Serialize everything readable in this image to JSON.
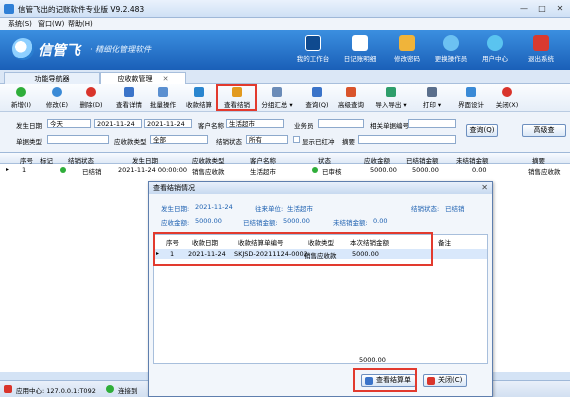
{
  "window": {
    "title": "信管飞出的记账软件专业版 V9.2.483",
    "min": "—",
    "max": "□",
    "close": "✕"
  },
  "menu": [
    "系统(S)",
    "窗口(W)",
    "帮助(H)"
  ],
  "banner": {
    "logo": "信管飞",
    "slogan": "· 精细化管理软件",
    "nav": [
      {
        "label": "我的工作台",
        "icon": "monitor-icon",
        "color": "#1b5fa8"
      },
      {
        "label": "日记账明细",
        "icon": "grid-icon",
        "color": "#2e7bd2"
      },
      {
        "label": "修改密码",
        "icon": "lock-icon",
        "color": "#e3a42a"
      },
      {
        "label": "更换操作员",
        "icon": "user-icon",
        "color": "#3fa0e6"
      },
      {
        "label": "用户中心",
        "icon": "globe-icon",
        "color": "#38b0e8"
      },
      {
        "label": "退出系统",
        "icon": "power-icon",
        "color": "#d93a2f"
      }
    ]
  },
  "tabs": [
    {
      "label": "功能导航器",
      "close": ""
    },
    {
      "label": "应收款管理",
      "close": "✕"
    }
  ],
  "toolbar": [
    {
      "label": "新增(I)",
      "icon": "add-icon",
      "color": "#2fae3a"
    },
    {
      "label": "修改(E)",
      "icon": "edit-icon",
      "color": "#3a8ad6"
    },
    {
      "label": "删除(D)",
      "icon": "delete-icon",
      "color": "#d9342b"
    },
    {
      "label": "查看详情",
      "icon": "detail-icon",
      "color": "#3b74c9"
    },
    {
      "label": "批量操作",
      "icon": "batch-icon",
      "color": "#5a8fd0"
    },
    {
      "label": "收款结算",
      "icon": "settle-icon",
      "color": "#2a86cf"
    },
    {
      "label": "查看结销",
      "icon": "view-settle-icon",
      "color": "#e29a1f"
    },
    {
      "label": "分组汇总 ▾",
      "icon": "group-icon",
      "color": "#6b8cb8"
    },
    {
      "label": "查询(Q)",
      "icon": "query-icon",
      "color": "#3b74c9"
    },
    {
      "label": "高级查询",
      "icon": "advanced-query-icon",
      "color": "#d9542b"
    },
    {
      "label": "导入导出 ▾",
      "icon": "import-export-icon",
      "color": "#2f9e6b"
    },
    {
      "label": "打印 ▾",
      "icon": "print-icon",
      "color": "#5a6f8c"
    },
    {
      "label": "界面设计",
      "icon": "design-icon",
      "color": "#3a8ad6"
    },
    {
      "label": "关闭(X)",
      "icon": "close-icon",
      "color": "#d9342b"
    }
  ],
  "filters": {
    "date_label": "发生日期",
    "date_preset": "今天",
    "date_from": "2021-11-24",
    "date_to": "2021-11-24",
    "customer_label": "客户名称",
    "customer_value": "生活超市",
    "clerk_label": "业务员",
    "clerk_value": "",
    "related_label": "相关单据编号",
    "related_value": "",
    "doctype_label": "单据类型",
    "doctype_value": "",
    "paytype_label": "应收款类型",
    "paytype_value": "全部",
    "status_label": "结销状态",
    "status_value": "所有",
    "red_label": "显示已红冲",
    "summary_label": "摘要",
    "summary_value": "",
    "query_button": "查询(Q)",
    "advanced_button": "高级查"
  },
  "grid": {
    "headers": [
      "序号",
      "标记",
      "结销状态",
      "发生日期",
      "应收款类型",
      "客户名称",
      "状态",
      "应收金额",
      "已结销金额",
      "未结销金额",
      "摘要"
    ],
    "rows": [
      {
        "no": "1",
        "flag": "",
        "settle_status": "已结销",
        "date": "2021-11-24 00:00:00",
        "type": "销售应收款",
        "customer": "生活超市",
        "status": "已审核",
        "amount": "5000.00",
        "settled": "5000.00",
        "unsettled": "0.00",
        "memo": "销售应收款"
      }
    ]
  },
  "dialog": {
    "title": "查看结销情况",
    "close": "✕",
    "date_label": "发生日期:",
    "date_value": "2021-11-24",
    "unit_label": "往来单位:",
    "unit_value": "生活超市",
    "status_label": "结销状态:",
    "status_value": "已结销",
    "amount_label": "应收金额:",
    "amount_value": "5000.00",
    "settled_label": "已结销金额:",
    "settled_value": "5000.00",
    "unsettled_label": "未结销金额:",
    "unsettled_value": "0.00",
    "headers": [
      "序号",
      "收款日期",
      "收款结算单编号",
      "收款类型",
      "本次结销金额",
      "备注"
    ],
    "rows": [
      {
        "no": "1",
        "date": "2021-11-24",
        "code": "SKJSD-20211124-0002",
        "type": "销售应收款",
        "amount": "5000.00",
        "memo": ""
      }
    ],
    "total": "5000.00",
    "view_button": "查看结算单",
    "close_button": "关闭(C)"
  },
  "statusbar": {
    "app_center": "应用中心: 127.0.0.1:T092",
    "connected": "连接到"
  },
  "colors": {
    "banner": "#1a5fb8",
    "highlight": "#e23a2e",
    "settled_dot": "#2fae3a"
  }
}
